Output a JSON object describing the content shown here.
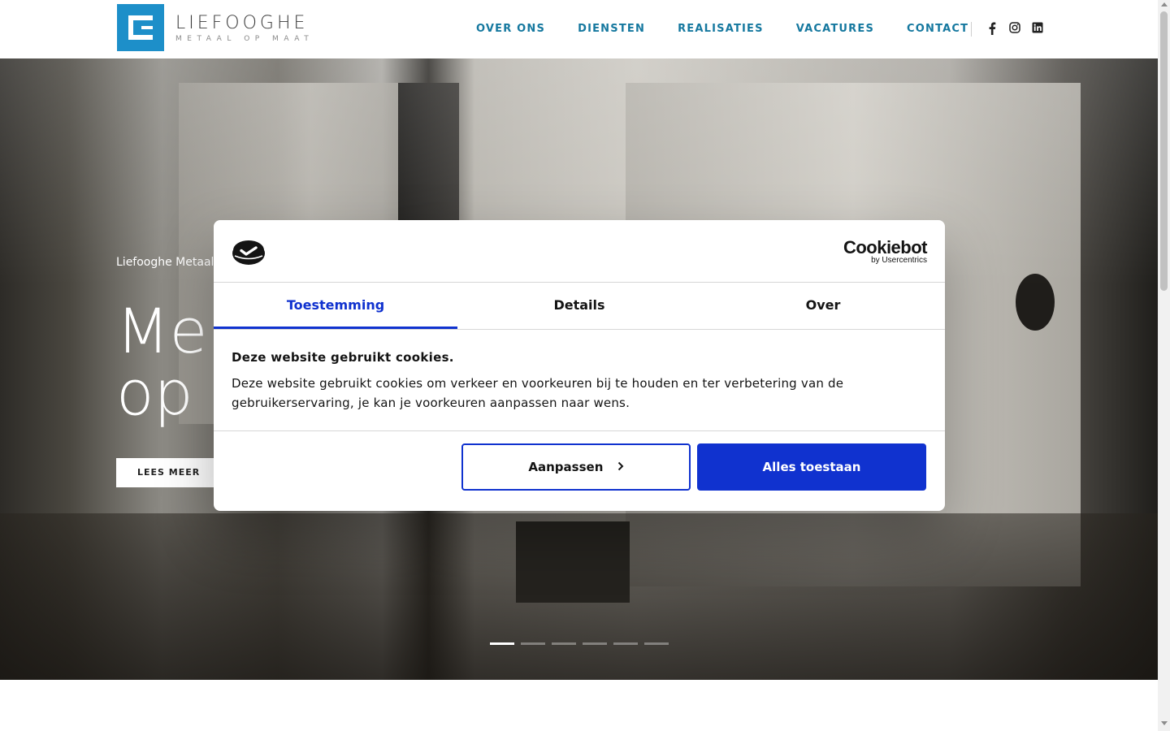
{
  "brand": {
    "name": "LIEFOOGHE",
    "tagline": "METAAL OP MAAT",
    "color": "#1d8fc9"
  },
  "nav": {
    "items": [
      {
        "label": "OVER ONS"
      },
      {
        "label": "DIENSTEN"
      },
      {
        "label": "REALISATIES"
      },
      {
        "label": "VACATURES"
      },
      {
        "label": "CONTACT"
      }
    ],
    "social": [
      "facebook-icon",
      "instagram-icon",
      "linkedin-icon"
    ]
  },
  "hero": {
    "eyebrow": "Liefooghe Metaal",
    "headline_line1": "Me",
    "headline_line2": "op",
    "cta": "LEES MEER",
    "slides": 6,
    "active_slide": 1
  },
  "cookie": {
    "brand_main": "Cookiebot",
    "brand_sub": "by Usercentrics",
    "tabs": [
      {
        "label": "Toestemming",
        "active": true
      },
      {
        "label": "Details",
        "active": false
      },
      {
        "label": "Over",
        "active": false
      }
    ],
    "title": "Deze website gebruikt cookies.",
    "text": "Deze website gebruikt cookies om verkeer en voorkeuren bij te houden en ter verbetering van de gebruikerservaring, je kan je voorkeuren aanpassen naar wens.",
    "customize_label": "Aanpassen",
    "allow_label": "Alles toestaan",
    "accent_color": "#1032cf"
  }
}
